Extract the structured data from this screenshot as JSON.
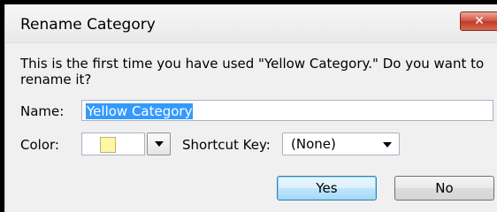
{
  "dialog": {
    "title": "Rename Category",
    "close_glyph": "✕",
    "message": "This is the first time you have used \"Yellow Category.\" Do you want to rename it?"
  },
  "form": {
    "name_label": "Name:",
    "name_value": "Yellow Category",
    "color_label": "Color:",
    "color_value": "#fff7a2",
    "shortcut_label": "Shortcut Key:",
    "shortcut_value": "(None)"
  },
  "buttons": {
    "yes": "Yes",
    "no": "No"
  },
  "icons": {
    "close": "close-icon",
    "dropdown": "chevron-down-icon"
  }
}
